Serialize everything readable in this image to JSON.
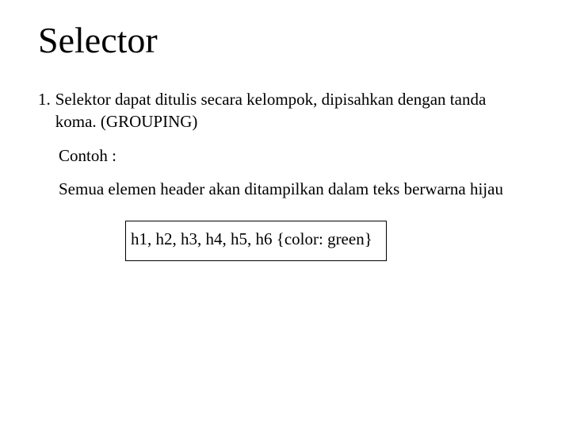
{
  "title": "Selector",
  "item1_number": "1.",
  "item1_text": "Selektor dapat ditulis secara kelompok, dipisahkan dengan tanda koma. (GROUPING)",
  "example_label": "Contoh :",
  "example_desc": "Semua elemen header akan ditampilkan dalam teks berwarna hijau",
  "code": "h1, h2, h3, h4, h5, h6 {color: green}"
}
